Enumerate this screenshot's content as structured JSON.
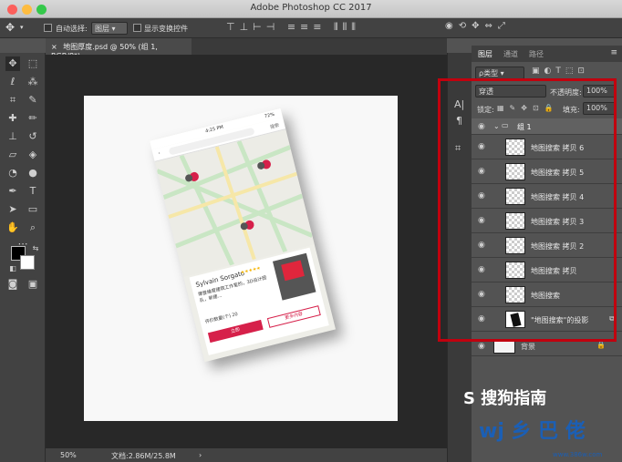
{
  "window": {
    "title": "Adobe Photoshop CC 2017"
  },
  "options_bar": {
    "auto_select_label": "自动选择:",
    "auto_select_value": "图层",
    "show_transform_label": "显示变换控件"
  },
  "document": {
    "tab_title": "地图厚度.psd @ 50% (组 1, RGB/8*)"
  },
  "status": {
    "zoom": "50%",
    "doc_size": "文档:2.86M/25.8M"
  },
  "phone": {
    "time": "4:25 PM",
    "battery": "72%",
    "search_button": "搜索",
    "card_name": "Sylvain Sorgato",
    "card_desc": "摩登维度建筑工作室的，3D设计团队，新建...",
    "card_rating_label": "评价数量(个) 20",
    "btn_primary": "立即",
    "btn_secondary": "更多内容"
  },
  "panel": {
    "tabs": [
      "图层",
      "通道",
      "路径"
    ],
    "filter_label": "ρ类型",
    "blend_mode": "穿透",
    "opacity_label": "不透明度:",
    "opacity_value": "100%",
    "lock_label": "锁定:",
    "fill_label": "填充:",
    "fill_value": "100%",
    "layers": [
      {
        "name": "组 1"
      },
      {
        "name": "地图搜索 拷贝 6"
      },
      {
        "name": "地图搜索 拷贝 5"
      },
      {
        "name": "地图搜索 拷贝 4"
      },
      {
        "name": "地图搜索 拷贝 3"
      },
      {
        "name": "地图搜索 拷贝 2"
      },
      {
        "name": "地图搜索 拷贝"
      },
      {
        "name": "地图搜索"
      },
      {
        "name": "\"地图搜索\"的投影"
      },
      {
        "name": "背景"
      }
    ]
  },
  "watermark": {
    "brand": "S 搜狗指南",
    "logo": "wj 乡 巴 佬",
    "url": "www.386w.com"
  },
  "colors": {
    "highlight": "#c1000e",
    "accent_red": "#d6204a"
  }
}
